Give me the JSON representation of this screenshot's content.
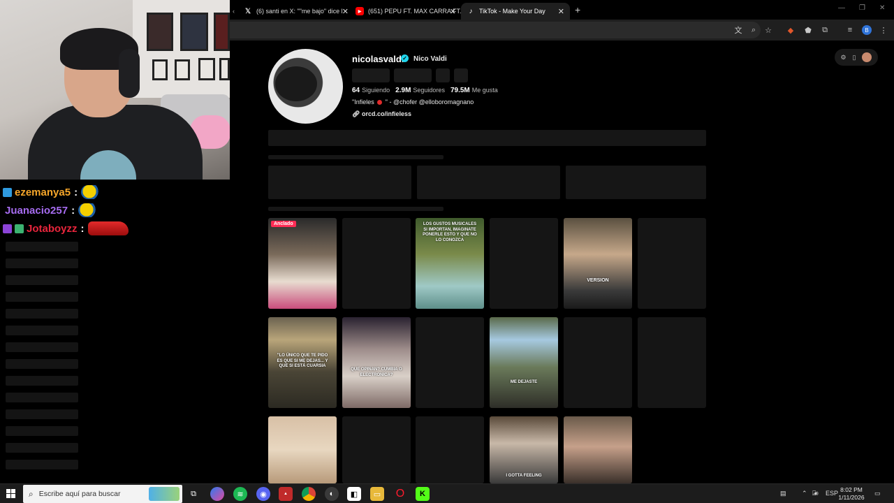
{
  "browser": {
    "tabs": [
      {
        "title": "(6) santi en X: \"\"me bajo\" dice l",
        "icon": "x-icon",
        "active": false
      },
      {
        "title": "(651) PEPU FT. MAX CARRA FT.",
        "icon": "youtube-icon",
        "active": false
      },
      {
        "title": "TikTok - Make Your Day",
        "icon": "tiktok-icon",
        "active": true
      }
    ],
    "new_tab": "+",
    "profile_initial": "B"
  },
  "chat": {
    "messages": [
      {
        "user": "ezemanya5",
        "color": "#f7a72a"
      },
      {
        "user": "Juanacio257",
        "color": "#a66cf0"
      },
      {
        "user": "Jotaboyzz",
        "color": "#e8253c"
      }
    ],
    "colon": ":"
  },
  "profile": {
    "username": "nicolasvaldi",
    "verified_mark": "✓",
    "nickname": "Nico Valdi",
    "following_count": "64",
    "following_label": "Siguiendo",
    "followers_count": "2.9M",
    "followers_label": "Seguidores",
    "likes_count": "79.5M",
    "likes_label": "Me gusta",
    "bio_prefix": "\"Infieles",
    "bio_suffix": "\" - @chofer @elloboromagnano",
    "link": "orcd.co/infieless"
  },
  "videos": {
    "pinned_label": "Anclado",
    "captions": {
      "v3": "LOS GUSTOS MUSICALES SI IMPORTAN, IMAGINATE PONERLE ESTO Y QUE NO LO CONOZCA",
      "v5": "VERSION",
      "v7": "\"LO ÚNICO QUE TE PIDO ES QUE SI ME DEJAS... Y QUE SI ESTÁ CUARSIA",
      "v8": "QUE OPINAN? CUMBIA O ELECTRONICA?",
      "v10": "ME DEJASTE",
      "v16": "I GOTTA FEELING"
    }
  },
  "taskbar": {
    "search_placeholder": "Escribe aquí para buscar",
    "language": "ESP",
    "time": "8:02 PM",
    "date": "1/11/2026"
  }
}
